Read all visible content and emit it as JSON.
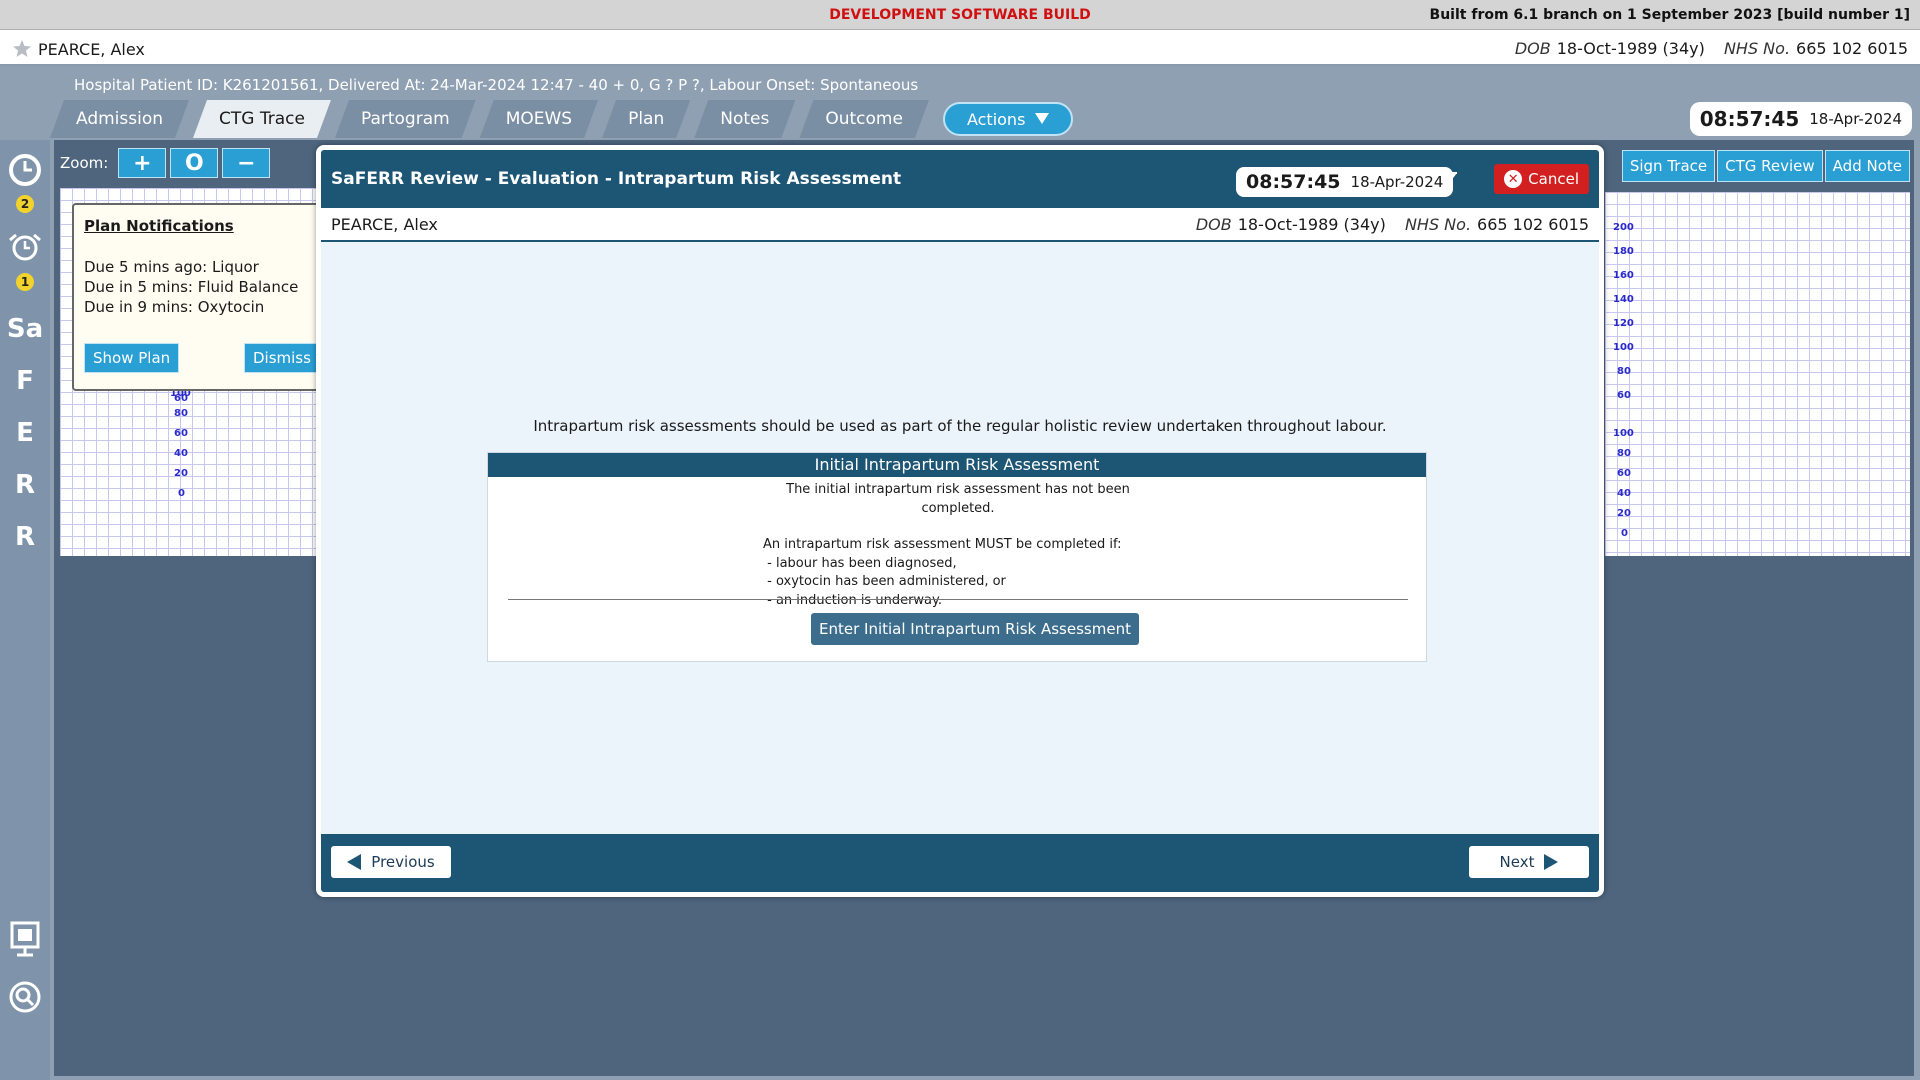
{
  "banner": {
    "center_text": "DEVELOPMENT SOFTWARE BUILD",
    "right_text": "Built from 6.1 branch on 1 September 2023 [build number 1]"
  },
  "patient": {
    "name": "PEARCE, Alex",
    "dob_label": "DOB",
    "dob_value": "18-Oct-1989 (34y)",
    "nhs_label": "NHS No.",
    "nhs_value": "665 102 6015"
  },
  "info_line": "Hospital Patient ID: K261201561, Delivered At: 24-Mar-2024 12:47 - 40 + 0, G ? P ?,   Labour Onset: Spontaneous",
  "tabs": [
    {
      "label": "Admission"
    },
    {
      "label": "CTG Trace"
    },
    {
      "label": "Partogram"
    },
    {
      "label": "MOEWS"
    },
    {
      "label": "Plan"
    },
    {
      "label": "Notes"
    },
    {
      "label": "Outcome"
    }
  ],
  "actions_label": "Actions",
  "clock": {
    "time": "08:57:45",
    "date": "18-Apr-2024"
  },
  "sidebar": {
    "badge_1": "2",
    "badge_2": "1",
    "letters": [
      "Sa",
      "F",
      "E",
      "R",
      "R"
    ]
  },
  "zoom": {
    "label": "Zoom:",
    "plus": "+",
    "reset": "O",
    "minus": "−"
  },
  "right_buttons": [
    "Sign Trace",
    "CTG Review",
    "Add Note"
  ],
  "ctg_scale_top": [
    "200",
    "180",
    "160",
    "140",
    "120",
    "100",
    "80",
    "60"
  ],
  "ctg_scale_bottom": [
    "100",
    "80",
    "60",
    "40",
    "20",
    "0"
  ],
  "plan_notifications": {
    "title": "Plan Notifications",
    "items": [
      "Due 5 mins ago: Liquor",
      "Due in 5 mins: Fluid Balance",
      "Due in 9 mins: Oxytocin"
    ],
    "show_label": "Show Plan",
    "dismiss_label": "Dismiss",
    "scale_60": "60"
  },
  "modal": {
    "title": "SaFERR Review - Evaluation - Intrapartum Risk Assessment",
    "time": "08:57:45",
    "date": "18-Apr-2024",
    "cancel_label": "Cancel",
    "intro": "Intrapartum risk assessments should be used as part of the regular holistic review undertaken throughout labour.",
    "panel": {
      "header": "Initial Intrapartum Risk Assessment",
      "status": "The initial intrapartum risk assessment has not been completed.",
      "must_line": "An intrapartum risk assessment MUST be completed if:",
      "bullets": [
        " - labour has been diagnosed,",
        " - oxytocin has been administered, or",
        " - an induction is underway."
      ],
      "enter_label": "Enter Initial Intrapartum Risk Assessment"
    },
    "previous_label": "Previous",
    "next_label": "Next"
  },
  "colors": {
    "header_dark": "#1d5574",
    "accent_blue": "#2a9fd4",
    "cancel_red": "#d21f1f",
    "dev_red": "#d01010",
    "badge_yellow": "#f2d22c"
  }
}
